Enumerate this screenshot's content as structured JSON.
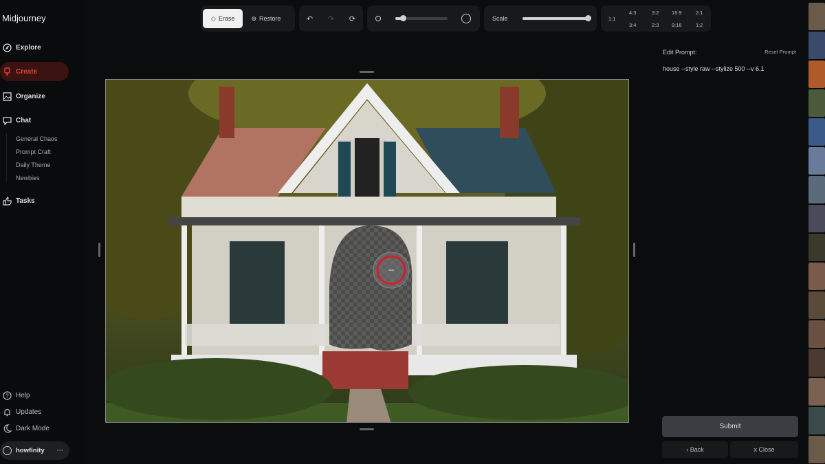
{
  "app": {
    "title": "Midjourney"
  },
  "sidebar": {
    "items": [
      {
        "label": "Explore",
        "icon": "compass-icon"
      },
      {
        "label": "Create",
        "icon": "brush-icon",
        "active": true
      },
      {
        "label": "Organize",
        "icon": "image-icon"
      },
      {
        "label": "Chat",
        "icon": "chat-icon"
      },
      {
        "label": "Tasks",
        "icon": "thumbs-up-icon"
      }
    ],
    "chat_channels": [
      "General Chaos",
      "Prompt Craft",
      "Daily Theme",
      "Newbies"
    ],
    "bottom": [
      {
        "label": "Help",
        "icon": "help-icon"
      },
      {
        "label": "Updates",
        "icon": "bell-icon"
      },
      {
        "label": "Dark Mode",
        "icon": "moon-icon"
      }
    ],
    "user": {
      "name": "howfinity",
      "menu": "···"
    }
  },
  "toolbar": {
    "erase": "Erase",
    "restore": "Restore",
    "brush_size": 0.15,
    "scale_label": "Scale",
    "scale": 1.0,
    "ratios": {
      "square": "1:1",
      "top": [
        "4:3",
        "3:2",
        "16:9",
        "2:1"
      ],
      "bottom": [
        "3:4",
        "2:3",
        "9:16",
        "1:2"
      ]
    }
  },
  "panel": {
    "edit_prompt_label": "Edit Prompt:",
    "reset_prompt": "Reset Prompt",
    "prompt": "house --style raw --stylize 500 --v 6.1",
    "submit": "Submit",
    "back": "‹ Back",
    "close": "x Close"
  },
  "colors": {
    "accent": "#e0412f",
    "active_bg": "#3a1210"
  }
}
